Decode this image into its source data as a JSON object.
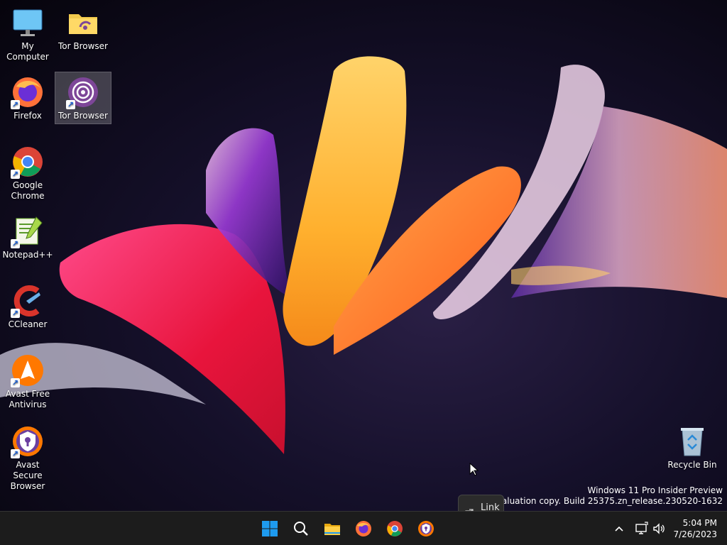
{
  "desktop": {
    "icons": [
      {
        "label": "My Computer",
        "icon": "monitor-icon",
        "shortcut": false
      },
      {
        "label": "Tor Browser",
        "icon": "folder-icon",
        "shortcut": false
      },
      {
        "label": "Firefox",
        "icon": "firefox-icon",
        "shortcut": true
      },
      {
        "label": "Tor Browser",
        "icon": "tor-browser-icon",
        "shortcut": true,
        "selected": true
      },
      {
        "label": "Google Chrome",
        "icon": "chrome-icon",
        "shortcut": true
      },
      {
        "label": "Notepad++",
        "icon": "notepad-plus-plus-icon",
        "shortcut": true
      },
      {
        "label": "CCleaner",
        "icon": "ccleaner-icon",
        "shortcut": true
      },
      {
        "label": "Avast Free Antivirus",
        "icon": "avast-icon",
        "shortcut": true
      },
      {
        "label": "Avast Secure Browser",
        "icon": "avast-secure-browser-icon",
        "shortcut": true
      },
      {
        "label": "Recycle Bin",
        "icon": "recycle-bin-icon",
        "shortcut": false
      }
    ],
    "watermark": {
      "line1": "Windows 11 Pro Insider Preview",
      "line2": "Evaluation copy. Build 25375.zn_release.230520-1632"
    },
    "tooltip": {
      "label": "Link",
      "icon": "external-link-icon"
    }
  },
  "taskbar": {
    "pinned": [
      {
        "name": "start",
        "icon": "windows-logo-icon"
      },
      {
        "name": "search",
        "icon": "search-icon"
      },
      {
        "name": "file-explorer",
        "icon": "folder-icon"
      },
      {
        "name": "firefox",
        "icon": "firefox-icon"
      },
      {
        "name": "chrome",
        "icon": "chrome-icon"
      },
      {
        "name": "avast-secure-browser",
        "icon": "avast-secure-browser-icon"
      }
    ],
    "tray": {
      "icons": [
        "chevron-up-icon",
        "network-icon",
        "volume-icon"
      ],
      "time": "5:04 PM",
      "date": "7/26/2023"
    }
  },
  "colors": {
    "taskbar_bg": "#1c1c1c",
    "windows_blue": "#1e9bf0",
    "firefox_orange": "#ff7139",
    "tor_purple": "#7d4698",
    "avast_orange": "#ff7800"
  }
}
